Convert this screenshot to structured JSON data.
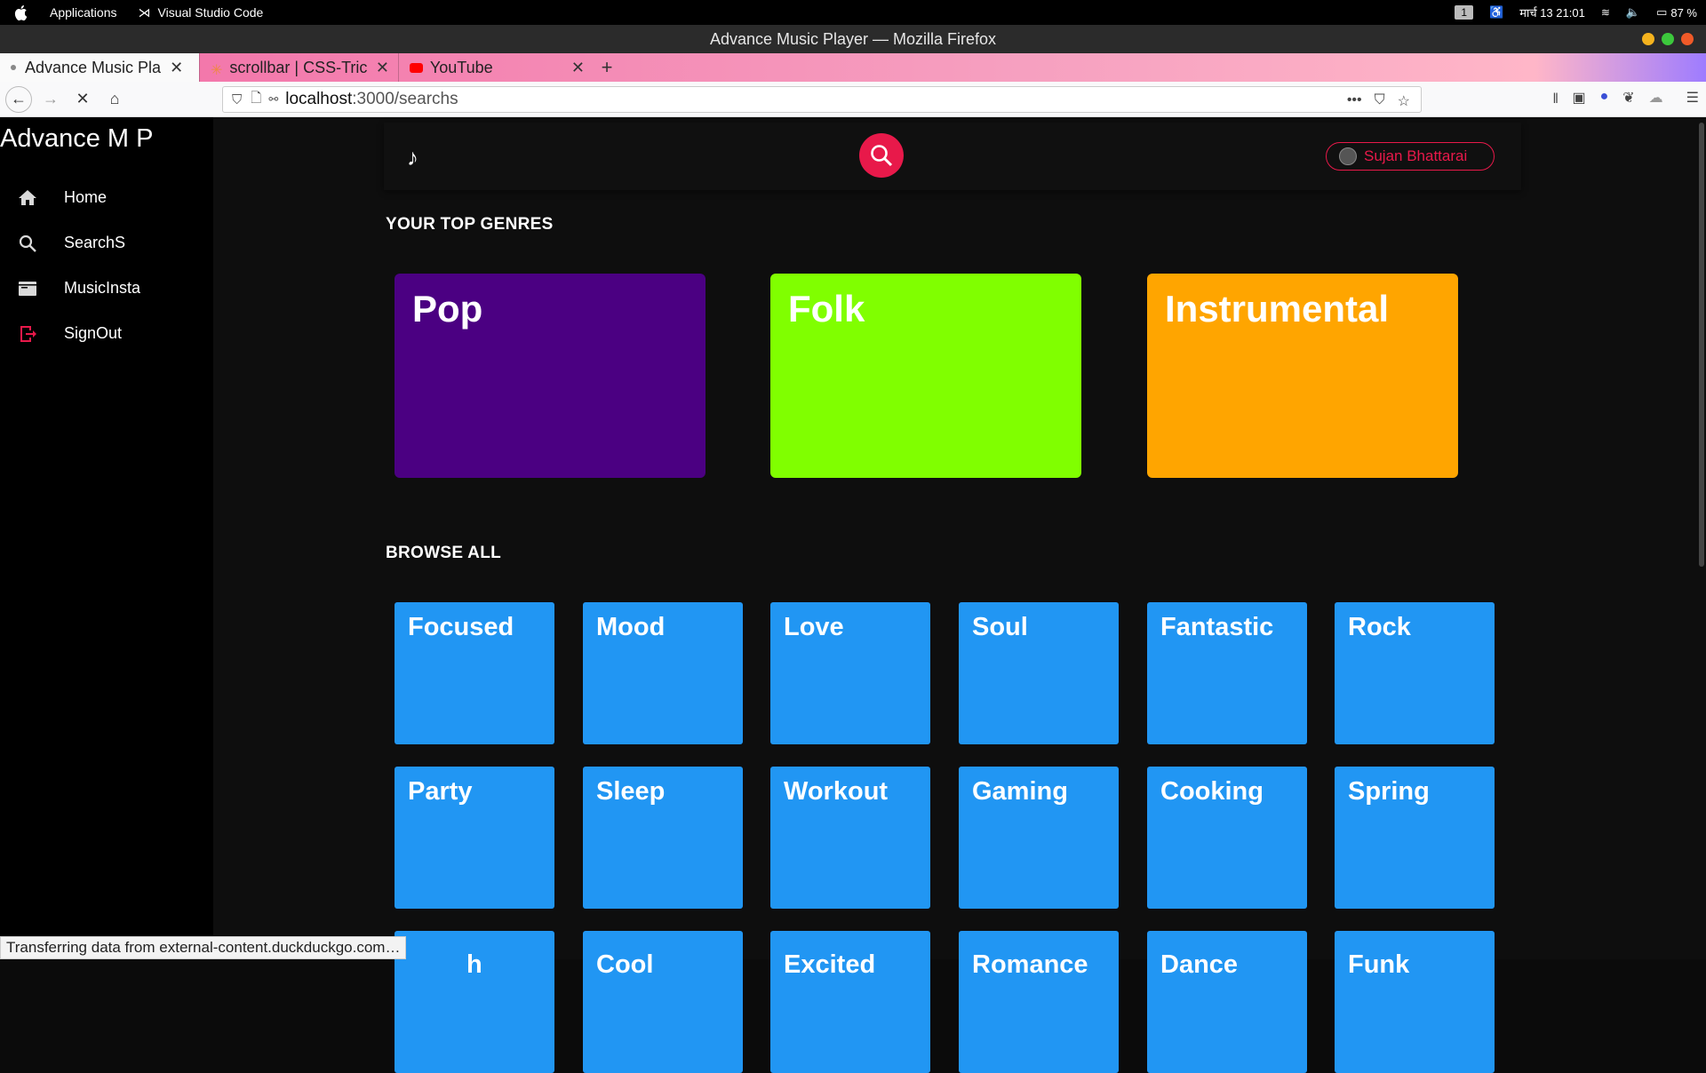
{
  "os": {
    "menu": "Applications",
    "app": "Visual Studio Code",
    "workspace": "1",
    "datetime": "मार्च 13  21:01",
    "battery": "87 %"
  },
  "window": {
    "title": "Advance Music Player — Mozilla Firefox"
  },
  "tabs": [
    {
      "title": "Advance Music Pla",
      "active": true
    },
    {
      "title": "scrollbar | CSS-Tric",
      "active": false
    },
    {
      "title": "YouTube",
      "active": false
    }
  ],
  "url": {
    "host": "localhost",
    "path": ":3000/searchs"
  },
  "sidebar": {
    "brand": "Advance M P",
    "items": [
      {
        "label": "Home",
        "icon": "home-icon"
      },
      {
        "label": "SearchS",
        "icon": "search-icon"
      },
      {
        "label": "MusicInsta",
        "icon": "album-icon"
      },
      {
        "label": "SignOut",
        "icon": "sign-out-icon"
      }
    ]
  },
  "header": {
    "user_name": "Sujan Bhattarai"
  },
  "top_genres": {
    "title": "YOUR TOP GENRES",
    "items": [
      {
        "name": "Pop",
        "color": "#4b0082"
      },
      {
        "name": "Folk",
        "color": "#80ff00"
      },
      {
        "name": "Instrumental",
        "color": "#ffa500"
      }
    ]
  },
  "browse": {
    "title": "BROWSE ALL",
    "items": [
      "Focused",
      "Mood",
      "Love",
      "Soul",
      "Fantastic",
      "Rock",
      "Party",
      "Sleep",
      "Workout",
      "Gaming",
      "Cooking",
      "Spring",
      "h",
      "Cool",
      "Excited",
      "Romance",
      "Dance",
      "Funk"
    ],
    "color": "#2196f3"
  },
  "status": "Transferring data from external-content.duckduckgo.com…",
  "accent": "#e8194a"
}
